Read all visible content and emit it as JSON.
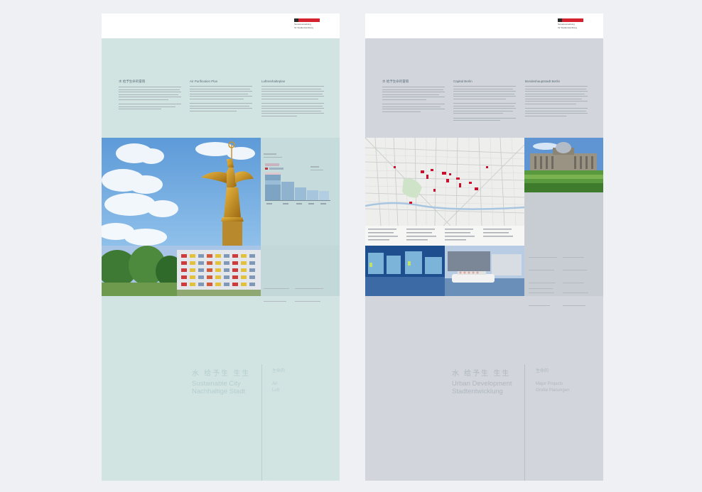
{
  "logo_text_line1": "Senatsverwaltung",
  "logo_text_line2": "für Stadtentwicklung",
  "left": {
    "col1_title": "水  给予生命的雷雨",
    "col2_title": "Air Purification Plan",
    "col3_title": "Luftreinhalteplan",
    "big_cn": "水  给予生 生生",
    "big_en_line1": "Sustainable City",
    "big_en_line2": "Nachhaltige Stadt",
    "side_cn": "生命的",
    "side_line1": "Air",
    "side_line2": "Luft"
  },
  "right": {
    "col1_title": "水  给予生命的雷雨",
    "col2_title": "Capital Berlin",
    "col3_title": "Bundeshauptstadt Berlin",
    "big_cn": "水  给予生 生生",
    "big_en_line1": "Urban Development",
    "big_en_line2": "Stadtentwicklung",
    "side_cn": "生命的",
    "side_line1": "Major Projects",
    "side_line2": "Große Planungen"
  },
  "colors": {
    "left_panel": "#d2e4e2",
    "right_panel": "#d2d5db",
    "logo_red": "#d4232f"
  },
  "icons": [
    "berlin-logo-icon",
    "victory-column-photo-icon",
    "apartment-photo-icon",
    "city-map-icon",
    "reichstag-photo-icon",
    "spree-boat-photo-icon",
    "bar-chart-icon"
  ]
}
